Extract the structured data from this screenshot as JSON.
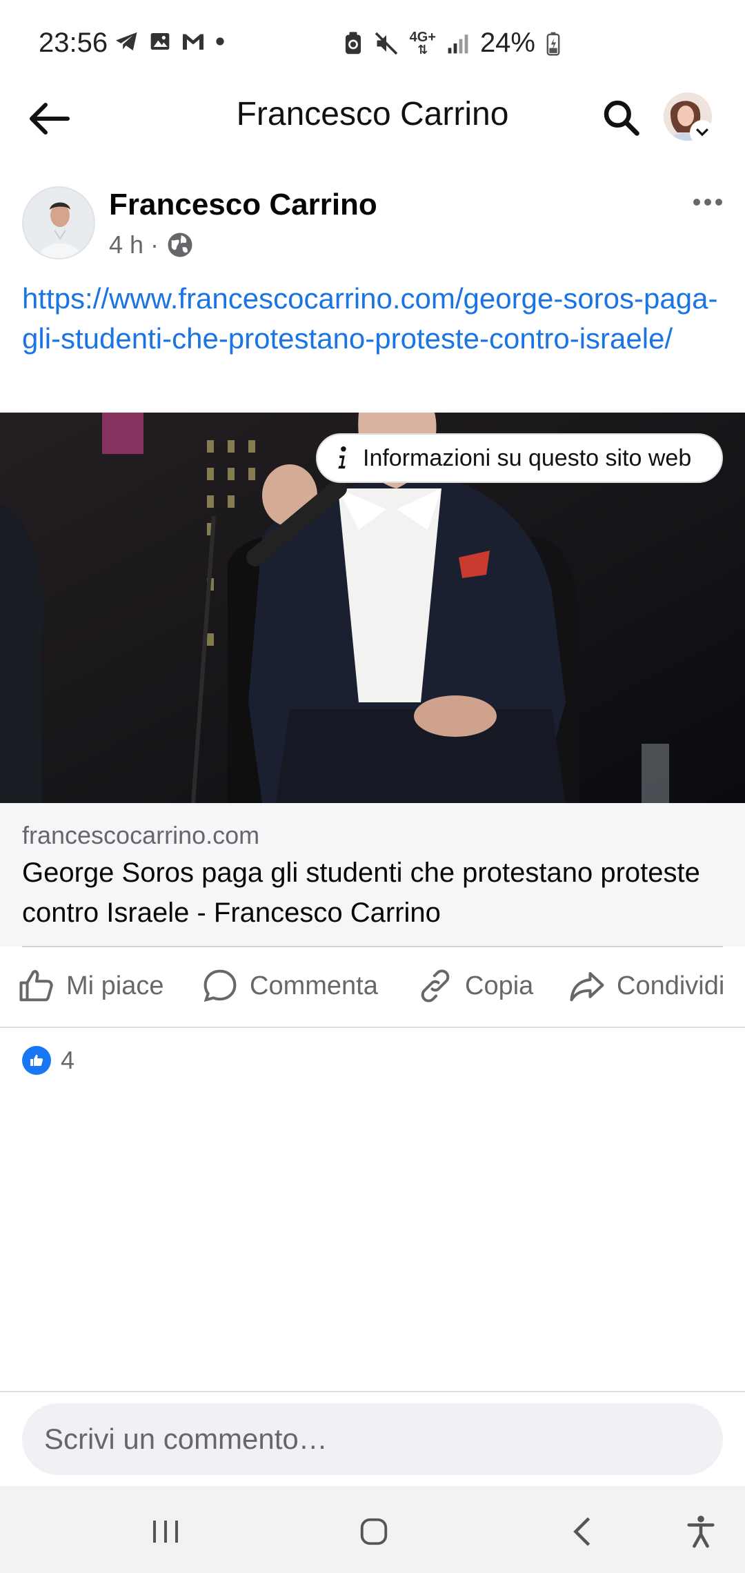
{
  "status_bar": {
    "time": "23:56",
    "battery": "24%",
    "network": "4G+",
    "left_icons": [
      "telegram-icon",
      "image-icon",
      "gmail-icon",
      "dot-icon"
    ],
    "right_icons": [
      "recycle-icon",
      "mute-icon",
      "network-icon",
      "signal-icon",
      "battery-icon"
    ]
  },
  "app_bar": {
    "title": "Francesco Carrino"
  },
  "post": {
    "author": "Francesco Carrino",
    "time": "4 h",
    "separator": "·",
    "privacy_icon": "globe-icon",
    "link": "https://www.francescocarrino.com/george-soros-paga-gli-studenti-che-protestano-proteste-contro-israele/",
    "site_info_label": "Informazioni su questo sito web",
    "preview": {
      "domain": "francescocarrino.com",
      "title": "George Soros paga gli studenti che protestano proteste contro Israele - Francesco Carrino"
    },
    "actions": {
      "like": "Mi piace",
      "comment": "Commenta",
      "copy": "Copia",
      "share": "Condividi"
    },
    "reaction_count": "4"
  },
  "composer": {
    "placeholder": "Scrivi un commento…"
  },
  "colors": {
    "link": "#1b74e4",
    "like_blue": "#1877f2",
    "secondary_text": "#65676b"
  }
}
